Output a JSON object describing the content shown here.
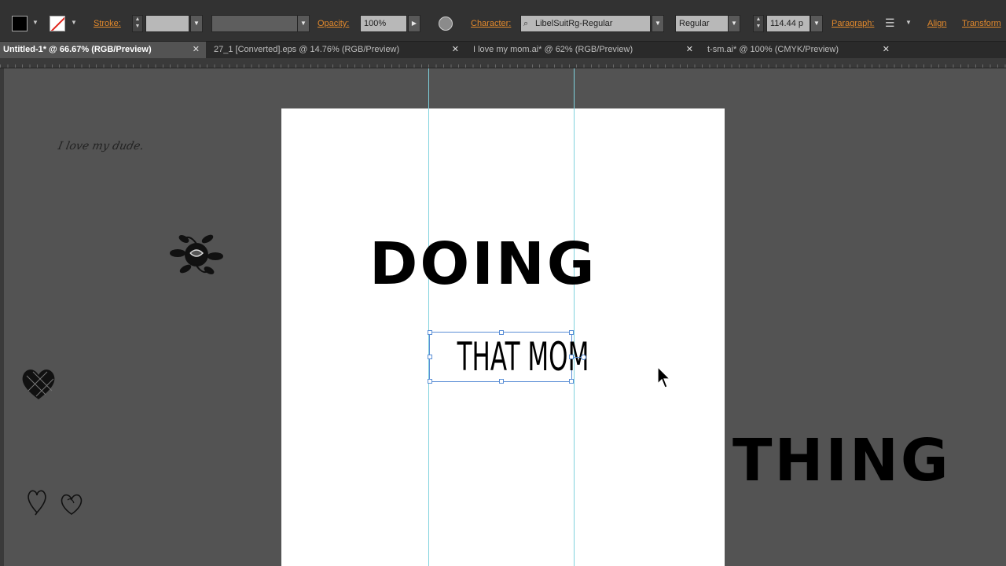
{
  "control_bar": {
    "stroke_label": "Stroke:",
    "opacity_label": "Opacity:",
    "opacity_value": "100%",
    "character_label": "Character:",
    "font_family": "LibelSuitRg-Regular",
    "font_style": "Regular",
    "font_size": "114.44 p",
    "paragraph_label": "Paragraph:",
    "align_label": "Align",
    "transform_label": "Transform",
    "fill_color": "#000000",
    "accent_color": "#e48a2c"
  },
  "tabs": [
    {
      "label": "Untitled-1* @ 66.67% (RGB/Preview)",
      "close": "✕",
      "active": true
    },
    {
      "label": "27_1 [Converted].eps @ 14.76% (RGB/Preview)",
      "close": "✕",
      "active": false
    },
    {
      "label": "I love my mom.ai* @ 62% (RGB/Preview)",
      "close": "✕",
      "active": false
    },
    {
      "label": "t-sm.ai* @ 100% (CMYK/Preview)",
      "close": "✕",
      "active": false
    }
  ],
  "canvas": {
    "text_doing": "DOING",
    "text_that_mom": "THAT MOM",
    "text_thing": "THING",
    "handwritten_text": "I love my dude.",
    "icons": [
      "rose-clipart",
      "heart-clipart",
      "small-heart-clipart",
      "small-heart-clipart"
    ]
  }
}
